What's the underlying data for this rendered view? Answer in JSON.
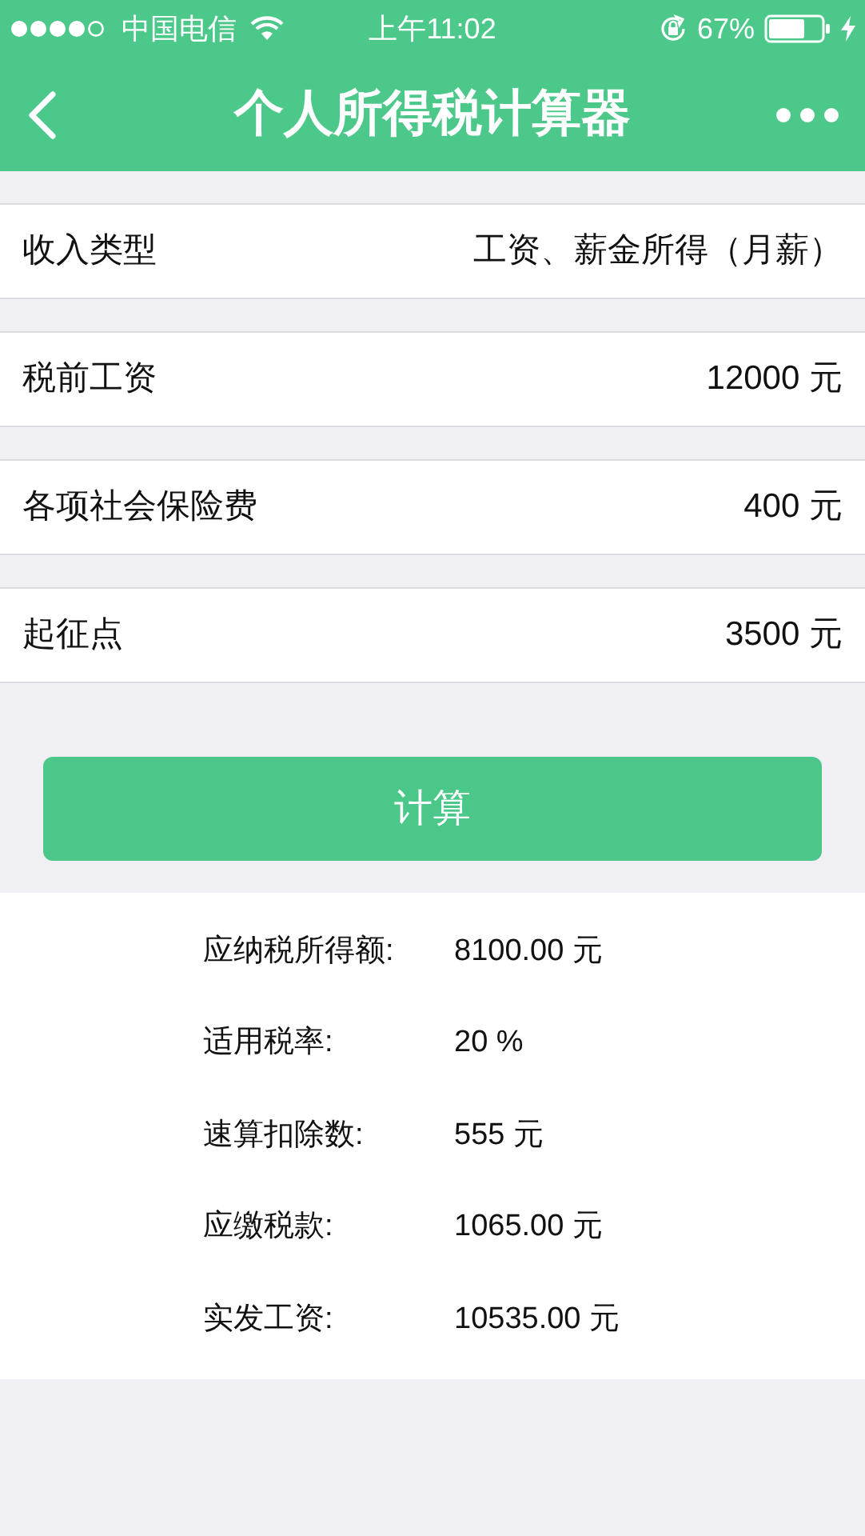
{
  "status_bar": {
    "carrier": "中国电信",
    "time": "上午11:02",
    "battery": "67%"
  },
  "nav": {
    "title": "个人所得税计算器"
  },
  "fields": [
    {
      "label": "收入类型",
      "value": "工资、薪金所得（月薪）"
    },
    {
      "label": "税前工资",
      "value": "12000 元"
    },
    {
      "label": "各项社会保险费",
      "value": "400 元"
    },
    {
      "label": "起征点",
      "value": "3500 元"
    }
  ],
  "button": "计算",
  "results": [
    {
      "label": "应纳税所得额:",
      "value": "8100.00 元"
    },
    {
      "label": "适用税率:",
      "value": "20 %"
    },
    {
      "label": "速算扣除数:",
      "value": "555 元"
    },
    {
      "label": "应缴税款:",
      "value": "1065.00 元"
    },
    {
      "label": "实发工资:",
      "value": "10535.00 元"
    }
  ]
}
